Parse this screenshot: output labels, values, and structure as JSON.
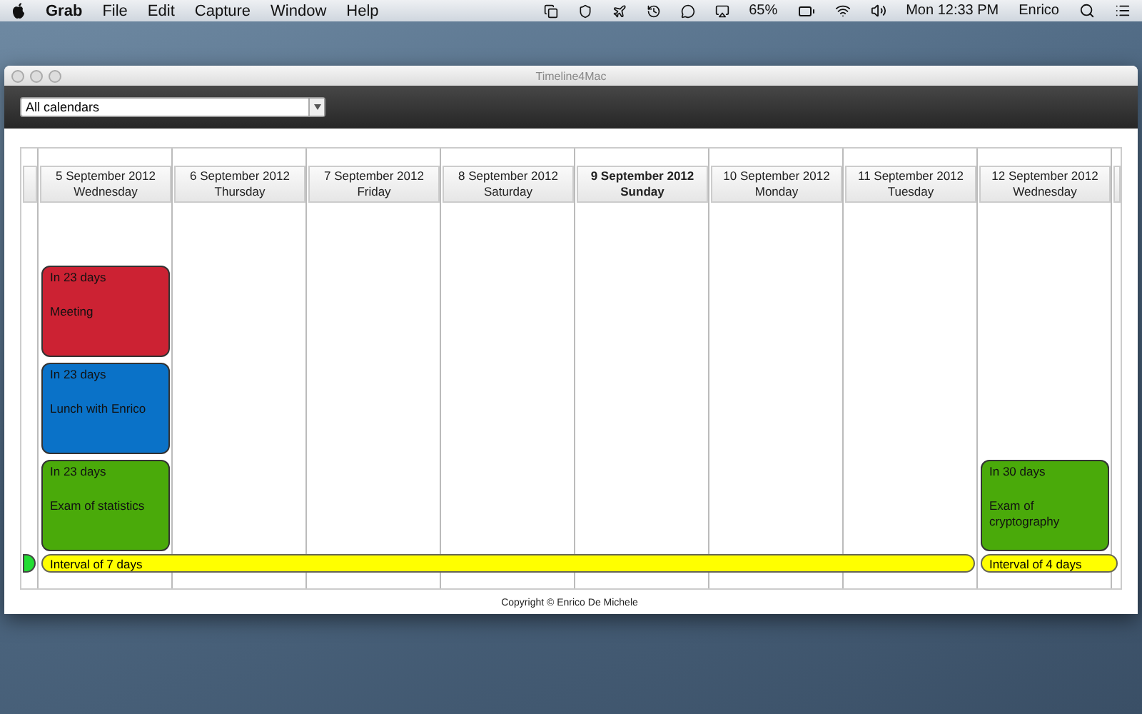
{
  "menubar": {
    "app": "Grab",
    "menus": [
      "File",
      "Edit",
      "Capture",
      "Window",
      "Help"
    ],
    "battery": "65%",
    "clock": "Mon 12:33 PM",
    "user": "Enrico"
  },
  "window": {
    "title": "Timeline4Mac"
  },
  "calendar_select": {
    "value": "All calendars"
  },
  "days": [
    {
      "date": "5 September 2012",
      "weekday": "Wednesday",
      "selected": false,
      "events": [
        {
          "countdown": "In 23 days",
          "title": "Meeting",
          "color": "#cc2233"
        },
        {
          "countdown": "In 23 days",
          "title": "Lunch with Enrico",
          "color": "#0a72c8"
        },
        {
          "countdown": "In 23 days",
          "title": "Exam of statistics",
          "color": "#4aaa0a"
        }
      ]
    },
    {
      "date": "6 September 2012",
      "weekday": "Thursday",
      "selected": false
    },
    {
      "date": "7 September 2012",
      "weekday": "Friday",
      "selected": false
    },
    {
      "date": "8 September 2012",
      "weekday": "Saturday",
      "selected": false
    },
    {
      "date": "9 September 2012",
      "weekday": "Sunday",
      "selected": true
    },
    {
      "date": "10 September 2012",
      "weekday": "Monday",
      "selected": false
    },
    {
      "date": "11 September 2012",
      "weekday": "Tuesday",
      "selected": false
    },
    {
      "date": "12 September 2012",
      "weekday": "Wednesday",
      "selected": false,
      "events": [
        {
          "countdown": "In 30 days",
          "title": "Exam of cryptography",
          "color": "#4aaa0a"
        }
      ]
    }
  ],
  "intervals": [
    {
      "label": "Interval of 7 days"
    },
    {
      "label": "Interval of 4 days"
    }
  ],
  "footer": "Copyright © Enrico De Michele"
}
